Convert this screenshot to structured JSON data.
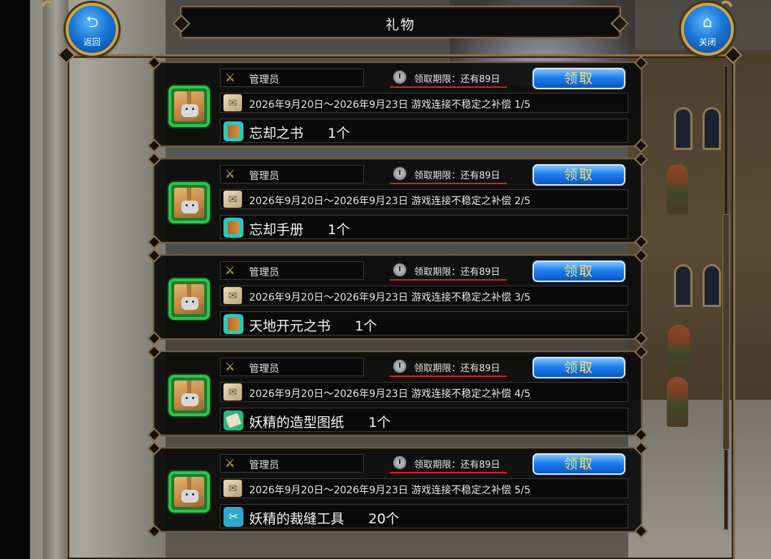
{
  "header": {
    "title": "礼物",
    "back": {
      "label": "返回",
      "icon": "return-arrow-icon"
    },
    "close": {
      "label": "关闭",
      "icon": "home-icon"
    }
  },
  "gifts": [
    {
      "sender": "管理员",
      "deadline": "领取期限：还有89日",
      "claim_label": "领取",
      "message": "2026年9月20日～2026年9月23日 游戏连接不稳定之补偿 1/5",
      "item_name": "忘却之书",
      "quantity": "1个",
      "item_icon": "book"
    },
    {
      "sender": "管理员",
      "deadline": "领取期限：还有89日",
      "claim_label": "领取",
      "message": "2026年9月20日～2026年9月23日 游戏连接不稳定之补偿 2/5",
      "item_name": "忘却手册",
      "quantity": "1个",
      "item_icon": "book"
    },
    {
      "sender": "管理员",
      "deadline": "领取期限：还有89日",
      "claim_label": "领取",
      "message": "2026年9月20日～2026年9月23日 游戏连接不稳定之补偿 3/5",
      "item_name": "天地开元之书",
      "quantity": "1个",
      "item_icon": "book"
    },
    {
      "sender": "管理员",
      "deadline": "领取期限：还有89日",
      "claim_label": "领取",
      "message": "2026年9月20日～2026年9月23日 游戏连接不稳定之补偿 4/5",
      "item_name": "妖精的造型图纸",
      "quantity": "1个",
      "item_icon": "paper"
    },
    {
      "sender": "管理员",
      "deadline": "领取期限：还有89日",
      "claim_label": "领取",
      "message": "2026年9月20日～2026年9月23日 游戏连接不稳定之补偿 5/5",
      "item_name": "妖精的裁缝工具",
      "quantity": "20个",
      "item_icon": "tool"
    }
  ],
  "colors": {
    "claim_button": "#1f7ff0",
    "claim_text": "#f6e06a",
    "deadline_underline": "#d2232a",
    "gift_box_border": "#33c24b",
    "frame_gold": "#86704e"
  }
}
